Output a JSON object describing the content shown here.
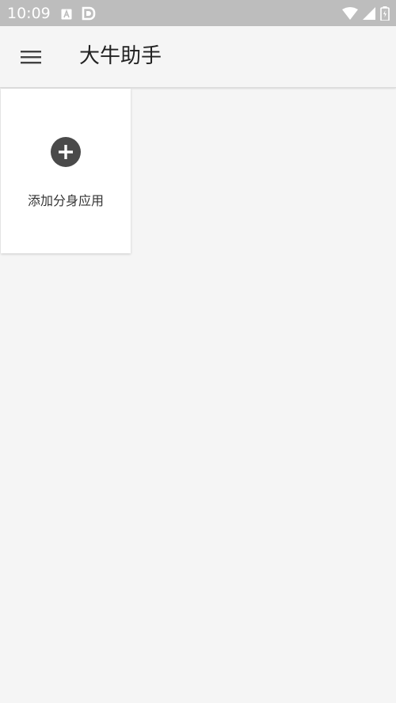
{
  "status_bar": {
    "time": "10:09",
    "left_icons": [
      "notification-a-icon",
      "notification-d-icon"
    ],
    "right_icons": [
      "wifi-icon",
      "signal-icon",
      "battery-icon"
    ],
    "color": "#bdbdbd"
  },
  "app_bar": {
    "menu_icon": "hamburger-menu-icon",
    "title": "大牛助手"
  },
  "main": {
    "add_card": {
      "icon": "plus-circle-icon",
      "label": "添加分身应用"
    }
  }
}
